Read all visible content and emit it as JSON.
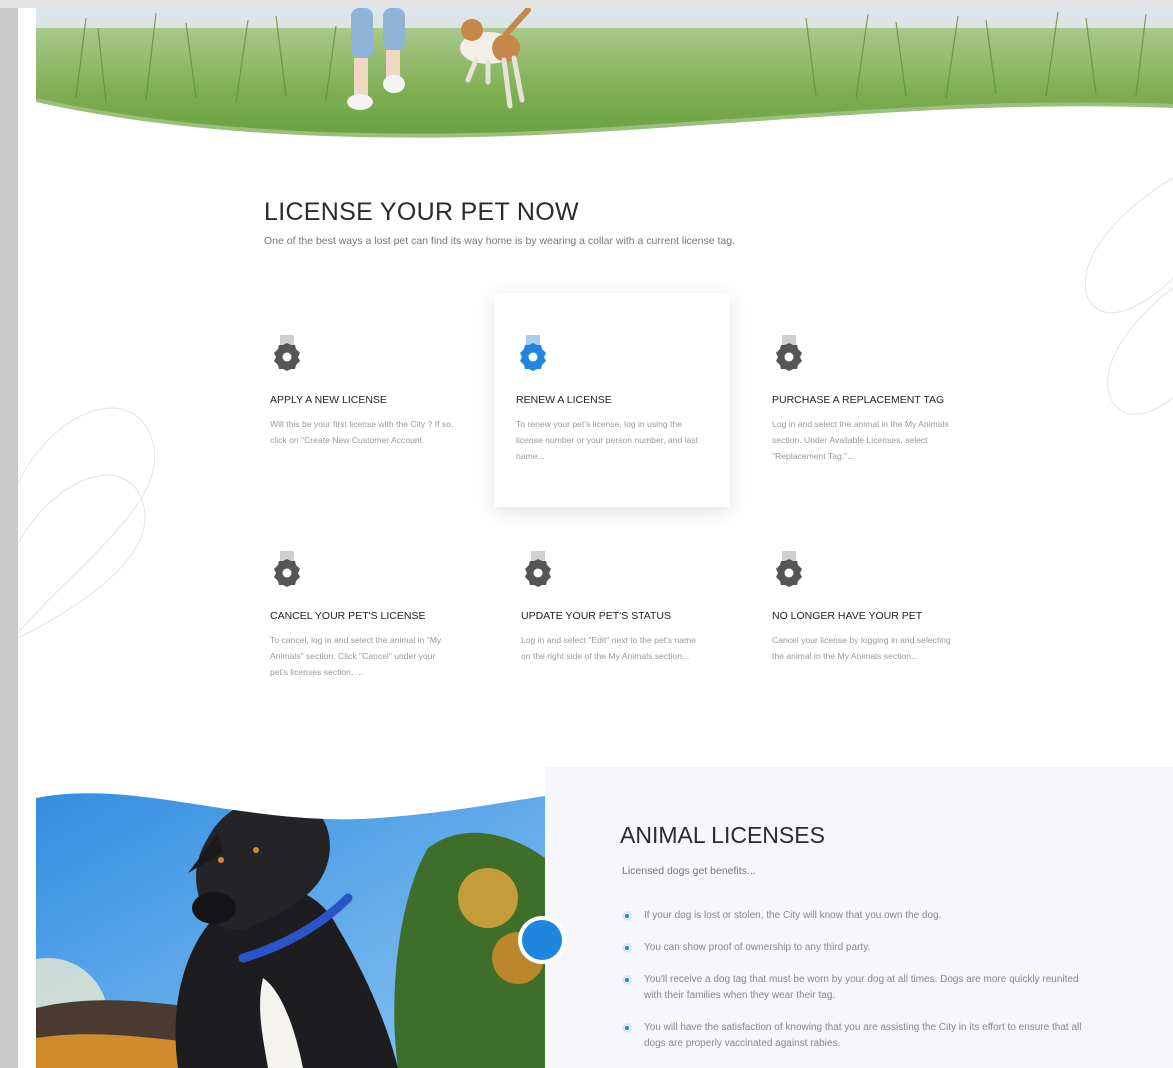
{
  "license": {
    "title": "LICENSE YOUR PET NOW",
    "subtitle": "One of the best ways a lost pet can find its way home is by wearing a collar with a current license tag."
  },
  "services": [
    {
      "title": "APPLY A NEW LICENSE",
      "desc": "Will this be your first license with the City ? If so, click on \"Create New Customer Account.",
      "icon": "badge-icon"
    },
    {
      "title": "RENEW A LICENSE",
      "desc": "To renew your pet's license, log in using the license number or your person number, and last name...",
      "icon": "badge-icon"
    },
    {
      "title": "PURCHASE A REPLACEMENT TAG",
      "desc": "Log in and select the animal in the My Animals section. Under Available Licenses, select \"Replacement Tag.\"...",
      "icon": "badge-icon"
    },
    {
      "title": "CANCEL YOUR PET'S LICENSE",
      "desc": "To cancel, log in and select the animal in \"My Animals\" section. Click \"Cancel\" under your pet's licenses section, ...",
      "icon": "badge-icon"
    },
    {
      "title": "UPDATE YOUR PET'S STATUS",
      "desc": "Log in and select \"Edit\" next to the pet's name on the right side of the My Animals section...",
      "icon": "badge-icon"
    },
    {
      "title": "NO LONGER HAVE YOUR PET",
      "desc": "Cancel your license by logging in and selecting the animal in the My Animals section...",
      "icon": "badge-icon"
    }
  ],
  "animal_licenses": {
    "title": "ANIMAL LICENSES",
    "subtitle": "Licensed dogs get benefits...",
    "benefits": [
      "If your dog is lost or stolen, the City will know that you own the dog.",
      "You can show proof of ownership to any third party.",
      "You'll receive a dog tag that must be worn by your dog at all times. Dogs are more quickly reunited with their families when they wear their tag.",
      "You will have the satisfaction of knowing that you are assisting the City in its effort to ensure that all dogs are properly vaccinated against rabies."
    ]
  },
  "colors": {
    "accent": "#1f86e0",
    "icon_gray": "#555555",
    "panel_bg": "#f6f6fb",
    "grass": "#7fae52"
  }
}
